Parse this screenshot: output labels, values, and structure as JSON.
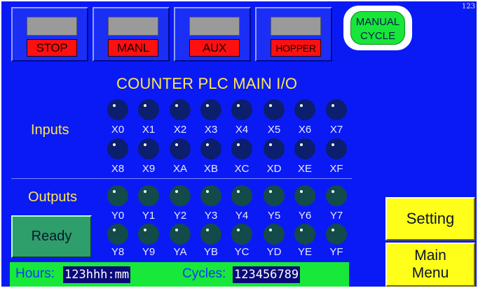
{
  "top_buttons": [
    {
      "label": "STOP"
    },
    {
      "label": "MANL"
    },
    {
      "label": "AUX"
    },
    {
      "label": "HOPPER"
    }
  ],
  "manual_cycle": {
    "line1": "MANUAL",
    "line2": "CYCLE"
  },
  "corner_number": "123",
  "title": "COUNTER PLC MAIN I/O",
  "inputs": {
    "label": "Inputs",
    "row1": [
      "X0",
      "X1",
      "X2",
      "X3",
      "X4",
      "X5",
      "X6",
      "X7"
    ],
    "row2": [
      "X8",
      "X9",
      "XA",
      "XB",
      "XC",
      "XD",
      "XE",
      "XF"
    ]
  },
  "outputs": {
    "label": "Outputs",
    "row1": [
      "Y0",
      "Y1",
      "Y2",
      "Y3",
      "Y4",
      "Y5",
      "Y6",
      "Y7"
    ],
    "row2": [
      "Y8",
      "Y9",
      "YA",
      "YB",
      "YC",
      "YD",
      "YE",
      "YF"
    ]
  },
  "ready_button": "Ready",
  "status": {
    "hours_label": "Hours:",
    "hours_value": "123hhh:mm",
    "cycles_label": "Cycles:",
    "cycles_value": "123456789"
  },
  "setting_button": "Setting",
  "main_menu_button": {
    "line1": "Main",
    "line2": "Menu"
  },
  "colors": {
    "background": "#0a1af5",
    "indicator_red": "#ff1010",
    "indicator_gray": "#9a9a9a",
    "title_yellow": "#ffe84a",
    "status_green": "#18e83a",
    "button_yellow": "#ffff1a",
    "ready_green": "#2e9e6a",
    "input_led": "#0c1e6e",
    "output_led": "#134a4a"
  }
}
